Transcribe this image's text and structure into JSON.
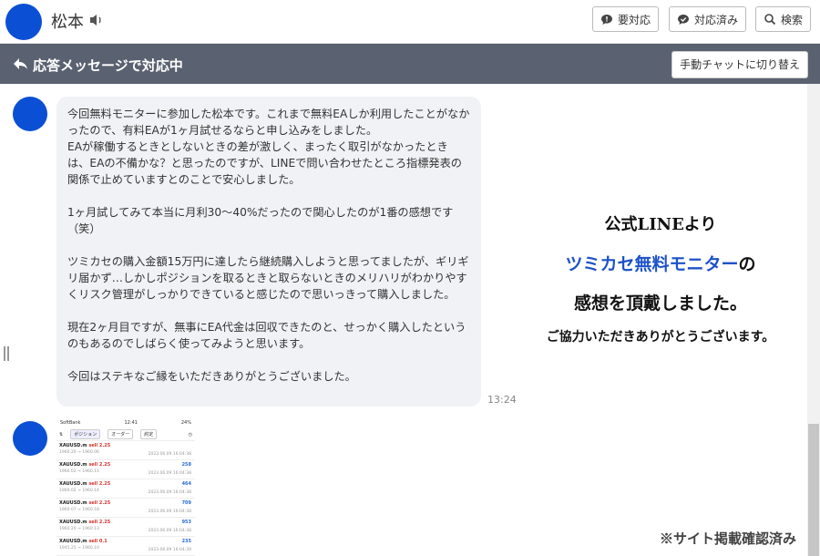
{
  "header": {
    "name": "松本",
    "buttons": {
      "needs_response": "要対応",
      "responded": "対応済み",
      "search": "検索"
    }
  },
  "status_bar": {
    "status": "応答メッセージで対応中",
    "switch_button": "手動チャットに切り替え"
  },
  "messages": [
    {
      "text": "今回無料モニターに参加した松本です。これまで無料EAしか利用したことがなかったので、有料EAが1ヶ月試せるならと申し込みをしました。\nEAが稼働するときとしないときの差が激しく、まったく取引がなかったときは、EAの不備かな？と思ったのですが、LINEで問い合わせたところ指標発表の関係で止めていますとのことで安心しました。\n\n1ヶ月試してみて本当に月利30～40%だったので関心したのが1番の感想です（笑）\n\nツミカセの購入金額15万円に達したら継続購入しようと思ってましたが、ギリギリ届かず…しかしポジションを取るときと取らないときのメリハリがわかりやすくリスク管理がしっかりできていると感じたので思いっきって購入しました。\n\n現在2ヶ月目ですが、無事にEA代金は回収できたのと、せっかく購入したというのもあるのでしばらく使ってみようと思います。\n\n今回はステキなご縁をいただきありがとうございました。",
      "time": "13:24"
    }
  ],
  "promo": {
    "line1": "公式LINEより",
    "line2_highlight": "ツミカセ無料モニター",
    "line2_rest": "の",
    "line3": "感想を頂戴しました。",
    "line4": "ご協力いただきありがとうございます。"
  },
  "screenshot": {
    "carrier": "SoftBank",
    "time": "12:41",
    "battery": "24%",
    "tabs": [
      "ポジション",
      "オーダー",
      "約定"
    ],
    "rows": [
      {
        "symbol": "XAUUSD.m",
        "side": "sell 2.25",
        "prices": "1960.20 → 1960.06",
        "amount": "",
        "datetime": "2023.06.09 16:04:38"
      },
      {
        "symbol": "XAUUSD.m",
        "side": "sell 2.25",
        "prices": "1960.02 → 1960.11",
        "amount": "258",
        "datetime": "2023.06.09 16:04:38"
      },
      {
        "symbol": "XAUUSD.m",
        "side": "sell 2.25",
        "prices": "1960.02 → 1960.14",
        "amount": "464",
        "datetime": "2023.06.09 16:04:38"
      },
      {
        "symbol": "XAUUSD.m",
        "side": "sell 2.25",
        "prices": "1960.07 → 1960.18",
        "amount": "709",
        "datetime": "2023.06.09 16:04:38"
      },
      {
        "symbol": "XAUUSD.m",
        "side": "sell 2.25",
        "prices": "1960.20 → 1960.13",
        "amount": "953",
        "datetime": "2023.06.09 16:04:38"
      },
      {
        "symbol": "XAUUSD.m",
        "side": "sell 0.1",
        "prices": "1945.25 → 1960.10",
        "amount": "235",
        "datetime": "2023.06.09 16:04:39"
      }
    ]
  },
  "footer_note": "※サイト掲載確認済み",
  "colors": {
    "avatar": "#0b4fd4",
    "status_bar": "#5a6170",
    "highlight": "#1d52c8"
  }
}
